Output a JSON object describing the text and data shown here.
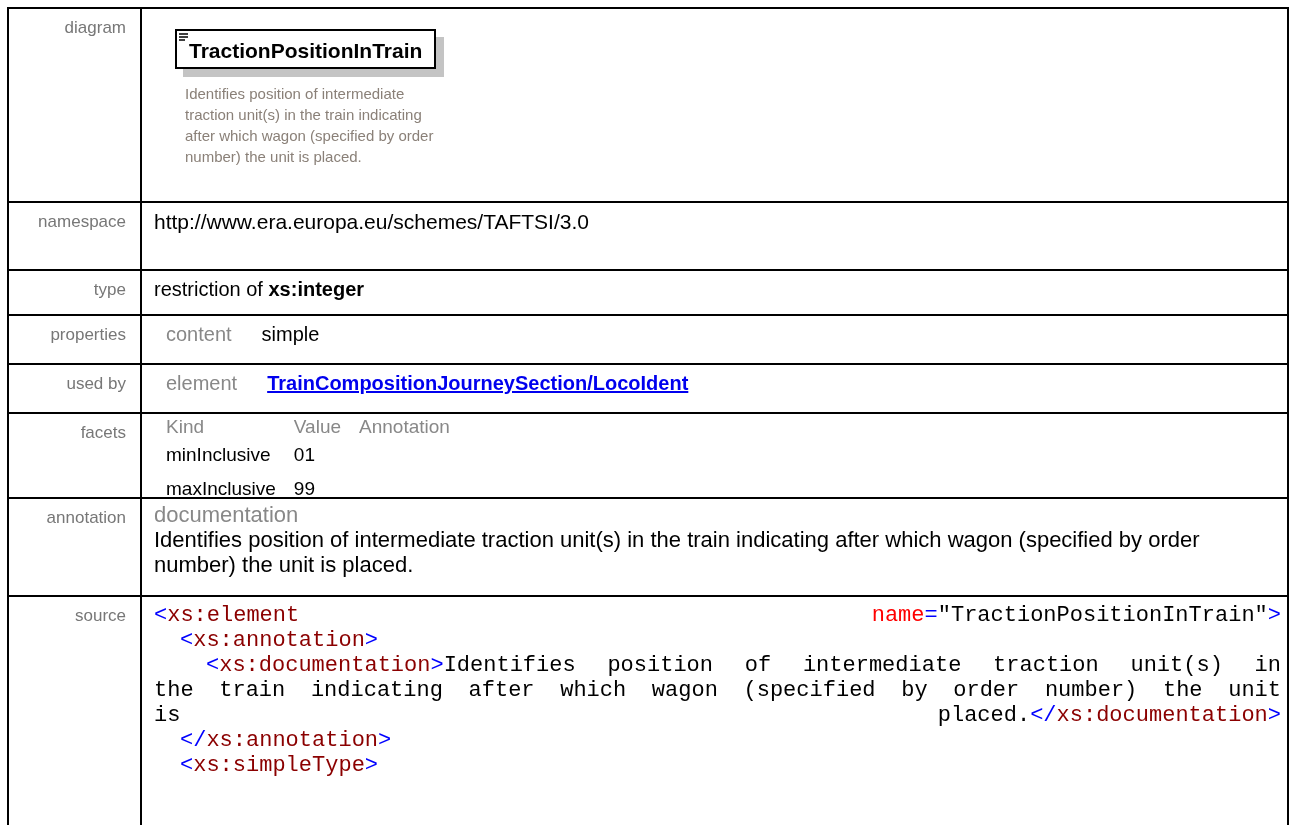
{
  "rows": [
    {
      "kind": "diagram",
      "label": "diagram",
      "title": "TractionPositionInTrain",
      "description": "Identifies position of intermediate traction unit(s) in the train indicating after which wagon (specified by order number) the unit is placed."
    },
    {
      "kind": "text",
      "label": "namespace",
      "value": "http://www.era.europa.eu/schemes/TAFTSI/3.0"
    },
    {
      "kind": "rich",
      "label": "type",
      "value": "restriction of **xs:integer**"
    },
    {
      "kind": "pair",
      "label": "properties",
      "key": "content",
      "value": "simple"
    },
    {
      "kind": "link",
      "label": "used by",
      "key": "element",
      "value": "TrainCompositionJourneySection/LocoIdent"
    },
    {
      "kind": "facets",
      "label": "facets",
      "columns": [
        "Kind",
        "Value",
        "Annotation"
      ],
      "items": [
        {
          "kind": "minInclusive",
          "value": "01"
        },
        {
          "kind": "maxInclusive",
          "value": "99"
        }
      ]
    },
    {
      "kind": "annotation",
      "label": "annotation",
      "heading": "documentation",
      "text": "Identifies position of intermediate traction unit(s) in the train indicating after which wagon (specified by order number) the unit is placed."
    },
    {
      "kind": "source",
      "label": "source",
      "lines": [
        {
          "justified": true,
          "segments": [
            {
              "kind": "punct",
              "text": "<"
            },
            {
              "kind": "tag",
              "text": "xs:element "
            },
            {
              "kind": "attr",
              "text": "name"
            },
            {
              "kind": "punct",
              "text": "="
            },
            {
              "kind": "text",
              "text": "\"TractionPositionInTrain\""
            },
            {
              "kind": "punct",
              "text": ">"
            }
          ],
          "children": [
            {
              "segments": [
                {
                  "kind": "punct",
                  "text": "<"
                },
                {
                  "kind": "tag",
                  "text": "xs:annotation"
                },
                {
                  "kind": "punct",
                  "text": ">"
                }
              ],
              "children": [
                {
                  "justified": true,
                  "segments": [
                    {
                      "kind": "punct",
                      "text": "<"
                    },
                    {
                      "kind": "tag",
                      "text": "xs:documentation"
                    },
                    {
                      "kind": "punct",
                      "text": ">"
                    },
                    {
                      "kind": "text",
                      "text": "Identifies position of intermediate traction unit(s) in"
                    }
                  ]
                }
              ]
            }
          ]
        },
        {
          "justified": true,
          "segments": [
            {
              "kind": "text",
              "text": "the train indicating after which wagon (specified by order number) the unit"
            }
          ]
        },
        {
          "justified": true,
          "segments": [
            {
              "kind": "text",
              "text": "is placed."
            },
            {
              "kind": "punct",
              "text": "</"
            },
            {
              "kind": "tag",
              "text": "xs:documentation"
            },
            {
              "kind": "punct",
              "text": ">"
            }
          ],
          "children": [
            {
              "segments": [
                {
                  "kind": "punct",
                  "text": "</"
                },
                {
                  "kind": "tag",
                  "text": "xs:annotation"
                },
                {
                  "kind": "punct",
                  "text": ">"
                }
              ]
            },
            {
              "segments": [
                {
                  "kind": "punct",
                  "text": "<"
                },
                {
                  "kind": "tag",
                  "text": "xs:simpleType"
                },
                {
                  "kind": "punct",
                  "text": ">"
                }
              ]
            }
          ]
        }
      ]
    }
  ]
}
